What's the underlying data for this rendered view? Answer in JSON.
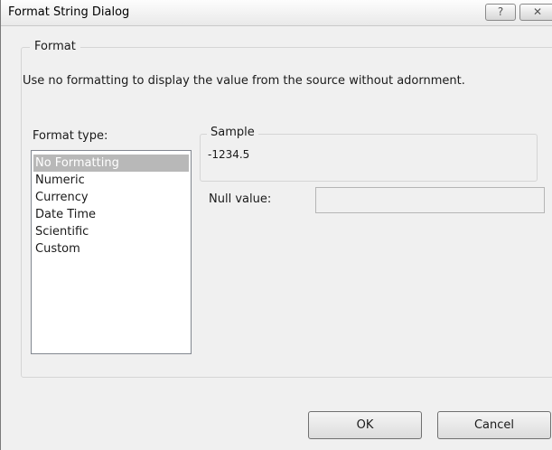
{
  "window": {
    "title": "Format String Dialog",
    "help_glyph": "?",
    "close_glyph": "✕"
  },
  "format_group": {
    "label": "Format",
    "description": "Use no formatting to display the value from the source without adornment."
  },
  "format_type": {
    "label": "Format type:",
    "items": [
      "No Formatting",
      "Numeric",
      "Currency",
      "Date Time",
      "Scientific",
      "Custom"
    ],
    "selected": "No Formatting"
  },
  "sample": {
    "label": "Sample",
    "value": "-1234.5"
  },
  "null_value": {
    "label": "Null value:",
    "value": ""
  },
  "buttons": {
    "ok": "OK",
    "cancel": "Cancel"
  },
  "colors": {
    "selection": "#b8b8b8",
    "dialog_bg": "#f0f0f0"
  }
}
